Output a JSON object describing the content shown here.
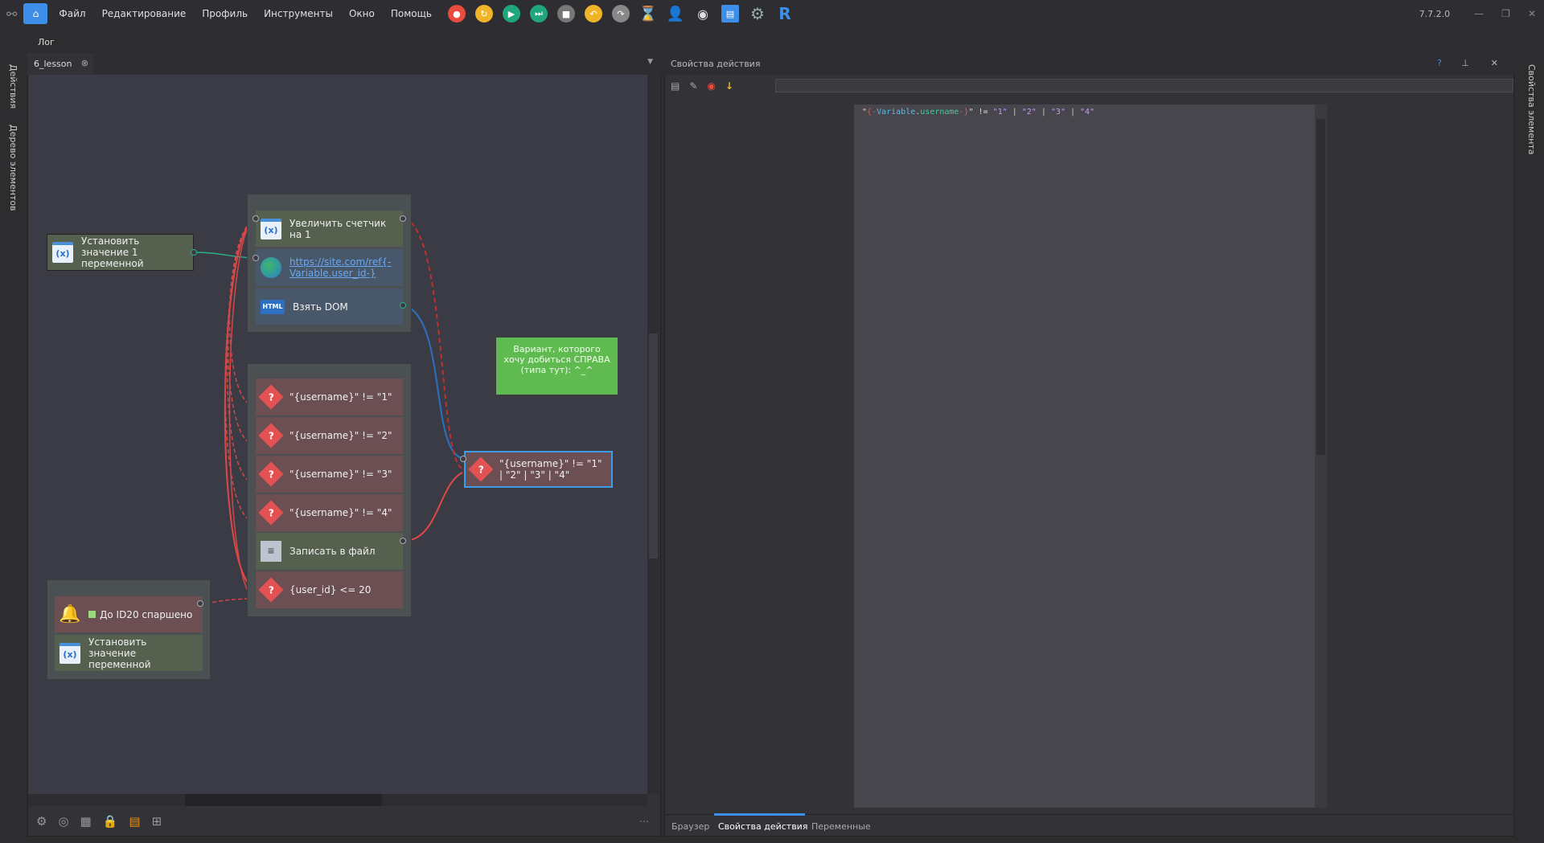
{
  "menu": {
    "items": [
      "Файл",
      "Редактирование",
      "Профиль",
      "Инструменты",
      "Окно",
      "Помощь"
    ],
    "version": "7.7.2.0"
  },
  "toolbar_icons": [
    "record-icon",
    "refresh-icon",
    "play-icon",
    "step-icon",
    "stop-icon",
    "undo-icon",
    "redo-icon",
    "hourglass-icon",
    "user-icon",
    "eye-icon",
    "save-icon",
    "gear-icon",
    "r-icon"
  ],
  "log_label": "Лог",
  "left_sidebar": [
    "Действия",
    "Дерево элементов"
  ],
  "right_sidebar": [
    "Свойства элемента"
  ],
  "editor": {
    "tab": "6_lesson"
  },
  "nodes": {
    "set1": "Установить значение 1 переменной",
    "inc": "Увеличить счетчик на 1",
    "url": "https://site.com/ref{-Variable.user_id-}",
    "dom": "Взять DOM",
    "html_badge": "HTML",
    "c1": "\"{username}\" != \"1\"",
    "c2": "\"{username}\" != \"2\"",
    "c3": "\"{username}\" != \"3\"",
    "c4": "\"{username}\" != \"4\"",
    "write": "Записать в файл",
    "uid": "{user_id} <= 20",
    "selected": "\"{username}\" != \"1\" | \"2\" | \"3\" | \"4\"",
    "done": "До ID20 спаршено",
    "set2": "Установить значение переменной"
  },
  "note": "Вариант, которого хочу добиться СПРАВА (типа тут): ^_^",
  "right_panel": {
    "title": "Свойства действия",
    "help": "?",
    "code": {
      "q1": "\"",
      "open": "{-",
      "var": "Variable",
      "dot": ".",
      "name": "username",
      "close": "-}",
      "rest": "\" != ",
      "v1": "\"1\"",
      "sep": " | ",
      "v2": "\"2\"",
      "v3": "\"3\"",
      "v4": "\"4\""
    },
    "tabs": [
      "Браузер",
      "Свойства действия",
      "Переменные"
    ],
    "active_tab": 1
  },
  "colors": {
    "accent": "#3d8ee8",
    "note": "#5fba4f",
    "red": "#e35252"
  }
}
